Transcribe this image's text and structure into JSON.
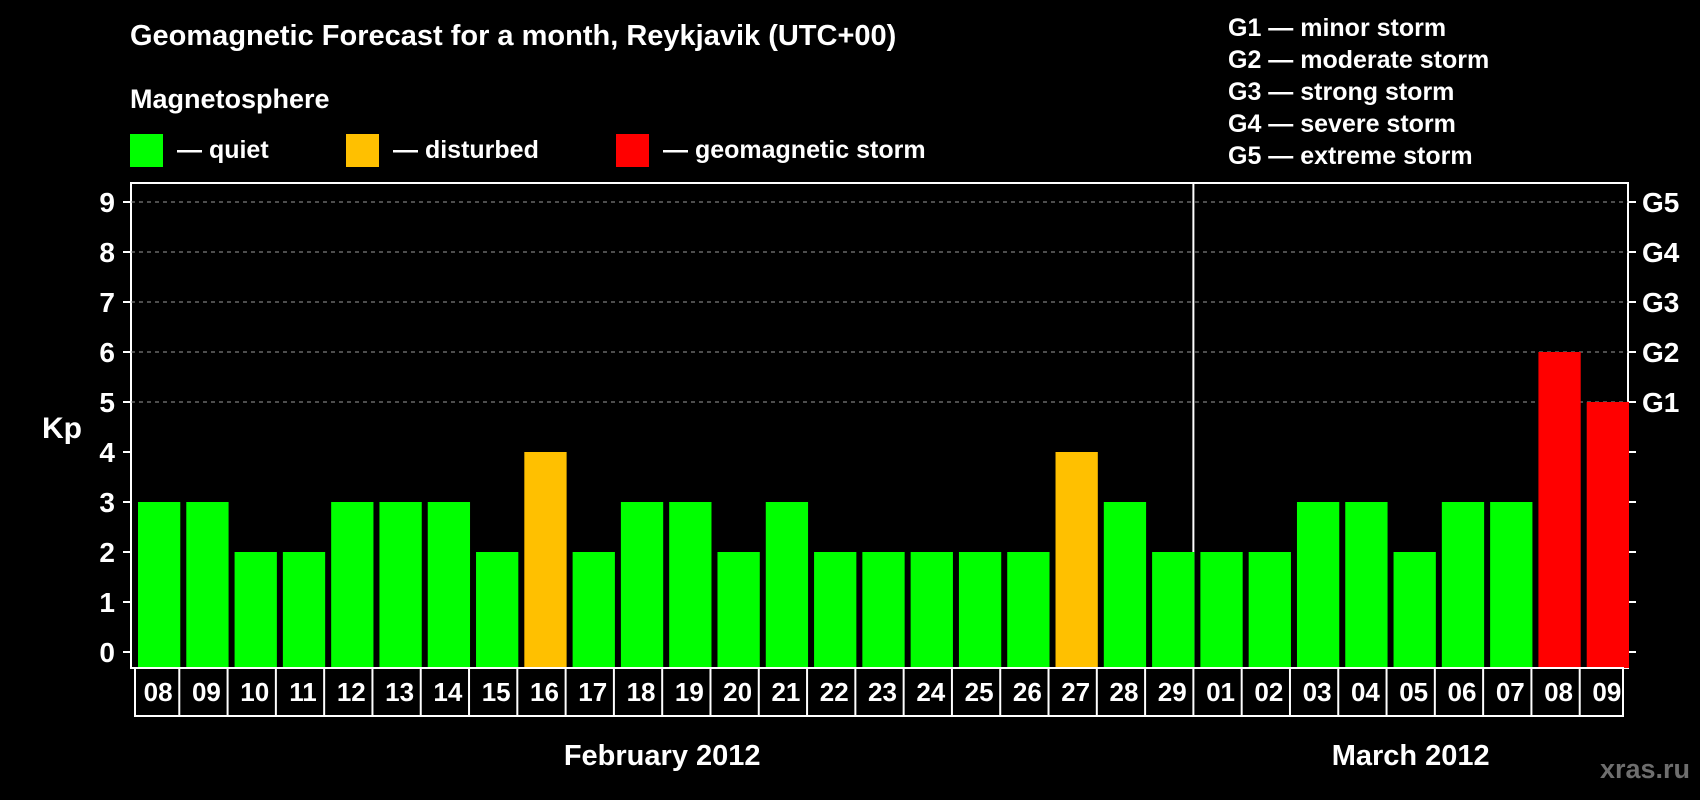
{
  "title": "Geomagnetic Forecast for a month, Reykjavik (UTC+00)",
  "magnetosphere": {
    "title": "Magnetosphere",
    "items": [
      {
        "label": "— quiet",
        "color": "#00ff00"
      },
      {
        "label": "— disturbed",
        "color": "#ffc000"
      },
      {
        "label": "— geomagnetic storm",
        "color": "#ff0000"
      }
    ]
  },
  "storm_legend": [
    "G1 — minor storm",
    "G2 — moderate storm",
    "G3 — strong storm",
    "G4 — severe storm",
    "G5 — extreme storm"
  ],
  "watermark": "xras.ru",
  "chart_data": {
    "type": "bar",
    "ylabel": "Kp",
    "ylim": [
      0,
      9
    ],
    "yticks": [
      "0",
      "1",
      "2",
      "3",
      "4",
      "5",
      "6",
      "7",
      "8",
      "9"
    ],
    "right_ticks": [
      {
        "value": 5,
        "label": "G1"
      },
      {
        "value": 6,
        "label": "G2"
      },
      {
        "value": 7,
        "label": "G3"
      },
      {
        "value": 8,
        "label": "G4"
      },
      {
        "value": 9,
        "label": "G5"
      }
    ],
    "grid": "dashed horizontal at 5-9",
    "categories": [
      "08",
      "09",
      "10",
      "11",
      "12",
      "13",
      "14",
      "15",
      "16",
      "17",
      "18",
      "19",
      "20",
      "21",
      "22",
      "23",
      "24",
      "25",
      "26",
      "27",
      "28",
      "29",
      "01",
      "02",
      "03",
      "04",
      "05",
      "06",
      "07",
      "08",
      "09"
    ],
    "values": [
      3,
      3,
      2,
      2,
      3,
      3,
      3,
      2,
      4,
      2,
      3,
      3,
      2,
      3,
      2,
      2,
      2,
      2,
      2,
      4,
      3,
      2,
      2,
      2,
      3,
      3,
      2,
      3,
      3,
      6,
      5
    ],
    "colors": {
      "quiet": "#00ff00",
      "disturbed": "#ffc000",
      "storm": "#ff0000"
    },
    "months": [
      {
        "label": "February 2012",
        "start": 0,
        "end": 21
      },
      {
        "label": "March 2012",
        "start": 22,
        "end": 30
      }
    ]
  }
}
